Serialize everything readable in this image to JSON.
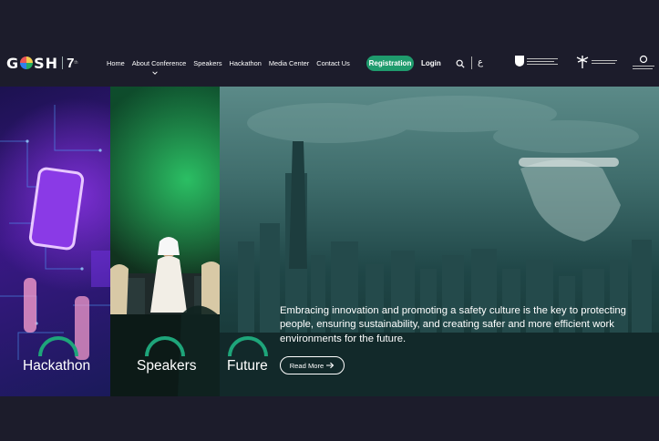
{
  "brand": {
    "logo_word_1": "G",
    "logo_word_2": "SH",
    "logo_number": "7",
    "logo_suffix": "th"
  },
  "nav": {
    "items": [
      "Home",
      "About Conference",
      "Speakers",
      "Hackathon",
      "Media Center",
      "Contact Us"
    ]
  },
  "actions": {
    "register_label": "Registration",
    "login_label": "Login",
    "lang_label": "ع"
  },
  "partners": [
    "partner-logo-1",
    "partner-logo-2",
    "partner-logo-3"
  ],
  "hero": {
    "panels": [
      {
        "label": "Hackathon"
      },
      {
        "label": "Speakers"
      },
      {
        "label": "Future"
      }
    ],
    "text": "Embracing innovation and promoting a safety culture is the key to protecting people, ensuring sustainability, and creating safer and more efficient work environments for the future.",
    "cta_label": "Read More"
  },
  "colors": {
    "accent": "#1f9b6d",
    "background": "#1c1c2b"
  }
}
